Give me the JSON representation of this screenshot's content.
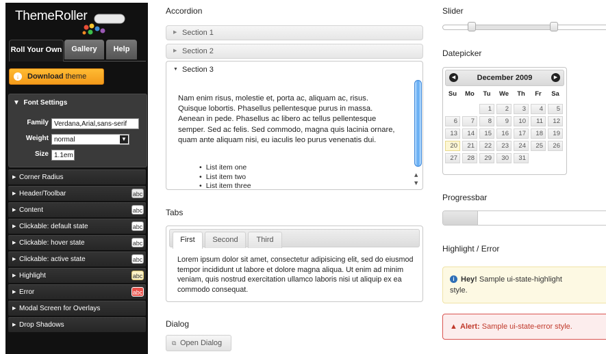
{
  "sidebar": {
    "logo": "ThemeRoller",
    "tabs": [
      "Roll Your Own",
      "Gallery",
      "Help"
    ],
    "download": {
      "bold": "Download",
      "rest": " theme"
    },
    "font_settings": {
      "title": "Font Settings",
      "family_label": "Family",
      "family_value": "Verdana,Arial,sans-serif",
      "weight_label": "Weight",
      "weight_value": "normal",
      "size_label": "Size",
      "size_value": "1.1em"
    },
    "sections": [
      {
        "label": "Corner Radius",
        "abc": ""
      },
      {
        "label": "Header/Toolbar",
        "abc": "abc"
      },
      {
        "label": "Content",
        "abc": "abc"
      },
      {
        "label": "Clickable: default state",
        "abc": "abc"
      },
      {
        "label": "Clickable: hover state",
        "abc": "abc"
      },
      {
        "label": "Clickable: active state",
        "abc": "abc"
      },
      {
        "label": "Highlight",
        "abc": "abc"
      },
      {
        "label": "Error",
        "abc": "abc"
      },
      {
        "label": "Modal Screen for Overlays",
        "abc": ""
      },
      {
        "label": "Drop Shadows",
        "abc": ""
      }
    ]
  },
  "accordion": {
    "title": "Accordion",
    "sections": [
      "Section 1",
      "Section 2",
      "Section 3"
    ],
    "body": "Nam enim risus, molestie et, porta ac, aliquam ac, risus. Quisque lobortis. Phasellus pellentesque purus in massa. Aenean in pede. Phasellus ac libero ac tellus pellentesque semper. Sed ac felis. Sed commodo, magna quis lacinia ornare, quam ante aliquam nisi, eu iaculis leo purus venenatis dui.",
    "list": [
      "List item one",
      "List item two",
      "List item three"
    ]
  },
  "tabs": {
    "title": "Tabs",
    "items": [
      "First",
      "Second",
      "Third"
    ],
    "body": "Lorem ipsum dolor sit amet, consectetur adipisicing elit, sed do eiusmod tempor incididunt ut labore et dolore magna aliqua. Ut enim ad minim veniam, quis nostrud exercitation ullamco laboris nisi ut aliquip ex ea commodo consequat."
  },
  "dialog": {
    "title": "Dialog",
    "button": "Open Dialog"
  },
  "slider": {
    "title": "Slider",
    "range": [
      17,
      65
    ]
  },
  "datepicker": {
    "title": "Datepicker",
    "month": "December 2009",
    "weekdays": [
      "Su",
      "Mo",
      "Tu",
      "We",
      "Th",
      "Fr",
      "Sa"
    ],
    "weeks": [
      [
        "",
        "",
        "1",
        "2",
        "3",
        "4",
        "5"
      ],
      [
        "6",
        "7",
        "8",
        "9",
        "10",
        "11",
        "12"
      ],
      [
        "13",
        "14",
        "15",
        "16",
        "17",
        "18",
        "19"
      ],
      [
        "20",
        "21",
        "22",
        "23",
        "24",
        "25",
        "26"
      ],
      [
        "27",
        "28",
        "29",
        "30",
        "31",
        "",
        ""
      ]
    ],
    "highlighted_day": "20"
  },
  "progressbar": {
    "title": "Progressbar",
    "value_fraction": 0.2
  },
  "highlight_error": {
    "title": "Highlight / Error",
    "highlight_bold": "Hey!",
    "highlight_text": " Sample ui-state-highlight",
    "highlight_text2": "style.",
    "error_bold": "Alert:",
    "error_text": " Sample ui-state-error style."
  },
  "colors": {
    "accent_orange": "#f39a1a",
    "error_red": "#c0392b",
    "highlight_yellow": "#fdf9e3"
  }
}
